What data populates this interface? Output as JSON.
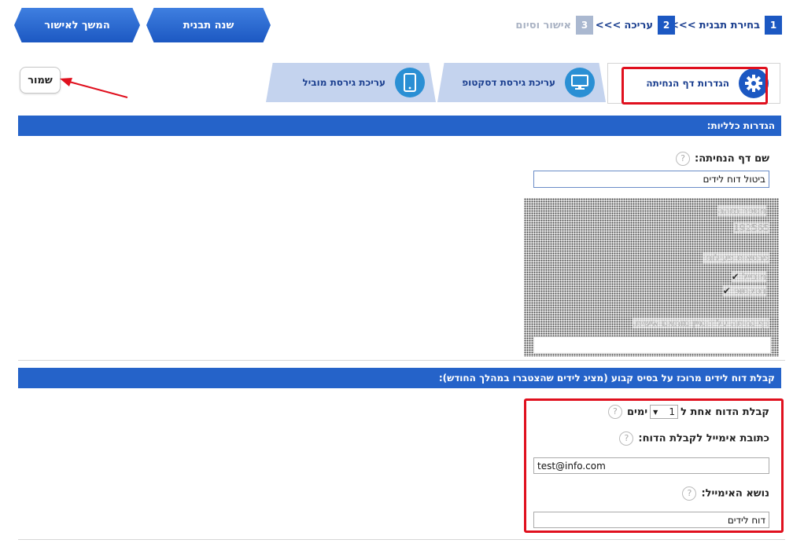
{
  "header": {
    "continue_button": "המשך לאישור",
    "change_template_button": "שנה תבנית",
    "steps": [
      {
        "num": "1",
        "label": "בחירת תבנית",
        "sep": ">>>"
      },
      {
        "num": "2",
        "label": "עריכה",
        "sep": ">>>"
      },
      {
        "num": "3",
        "label": "אישור וסיום"
      }
    ]
  },
  "save_button": "שמור",
  "tabs": [
    {
      "label": "הגדרות דף הנחיתה",
      "icon": "gear-icon",
      "active": true
    },
    {
      "label": "עריכת גירסת דסקטופ",
      "icon": "monitor-icon"
    },
    {
      "label": "עריכת גירסת מוביל",
      "icon": "mobile-icon"
    }
  ],
  "general": {
    "title": "הגדרות כלליות:",
    "page_name_label": "שם דף הנחיתה:",
    "page_name_value": "ביטול דוח לידים",
    "id_label": "מספר מזהה",
    "id_value": "192565",
    "versions_label": "גירסאות פעילות:",
    "version_mobile": "מובייל",
    "version_desktop": "דסקטופ",
    "domain_label": "דף נחיתה על דומיין מותאם אישית:",
    "help_glyph": "?"
  },
  "report": {
    "title": "קבלת דוח לידים מרוכז על בסיס קבוע (מציג לידים שהצטברו במהלך החודש):",
    "freq_prefix": "קבלת הדוח אחת ל",
    "freq_value": "1",
    "freq_suffix": "ימים",
    "email_label": "כתובת אימייל לקבלת הדוח:",
    "email_value": "test@info.com",
    "subject_label": "נושא האימייל:",
    "subject_value": "דוח לידים"
  },
  "colors": {
    "primary": "#1c58c2",
    "section_bar": "#2563c9",
    "highlight": "#e0101e"
  }
}
